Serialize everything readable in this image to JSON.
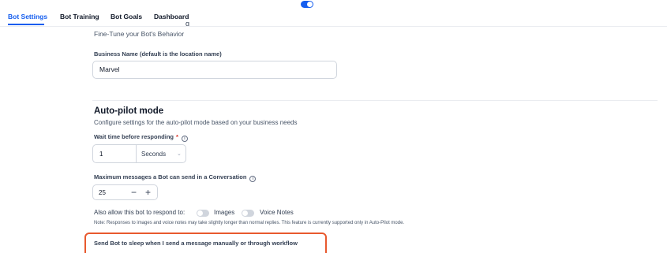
{
  "tabs": [
    {
      "label": "Bot Settings",
      "active": true
    },
    {
      "label": "Bot Training",
      "active": false
    },
    {
      "label": "Bot Goals",
      "active": false
    },
    {
      "label": "Dashboard",
      "active": false
    }
  ],
  "header": {
    "subtitle": "Fine-Tune your Bot's Behavior"
  },
  "business": {
    "label": "Business Name (default is the location name)",
    "value": "Marvel"
  },
  "autopilot": {
    "title": "Auto-pilot mode",
    "description": "Configure settings for the auto-pilot mode based on your business needs",
    "wait_label": "Wait time before responding",
    "wait_required_marker": "*",
    "wait_value": "1",
    "wait_unit": "Seconds",
    "max_label": "Maximum messages a Bot can send in a Conversation",
    "max_value": "25",
    "minus": "−",
    "plus": "+",
    "also_label": "Also allow this bot to respond to:",
    "images_label": "Images",
    "images_on": false,
    "voice_label": "Voice Notes",
    "voice_on": false,
    "note": "Note: Responses to images and voice notes may take slightly longer than normal replies. This feature is currently supported only in Auto-Pilot mode.",
    "sleep_label": "Send Bot to sleep when I send a message manually or through workflow",
    "sleep_on": true
  },
  "colors": {
    "accent": "#155eef",
    "highlight": "#e8592e",
    "required": "#d92d20"
  }
}
